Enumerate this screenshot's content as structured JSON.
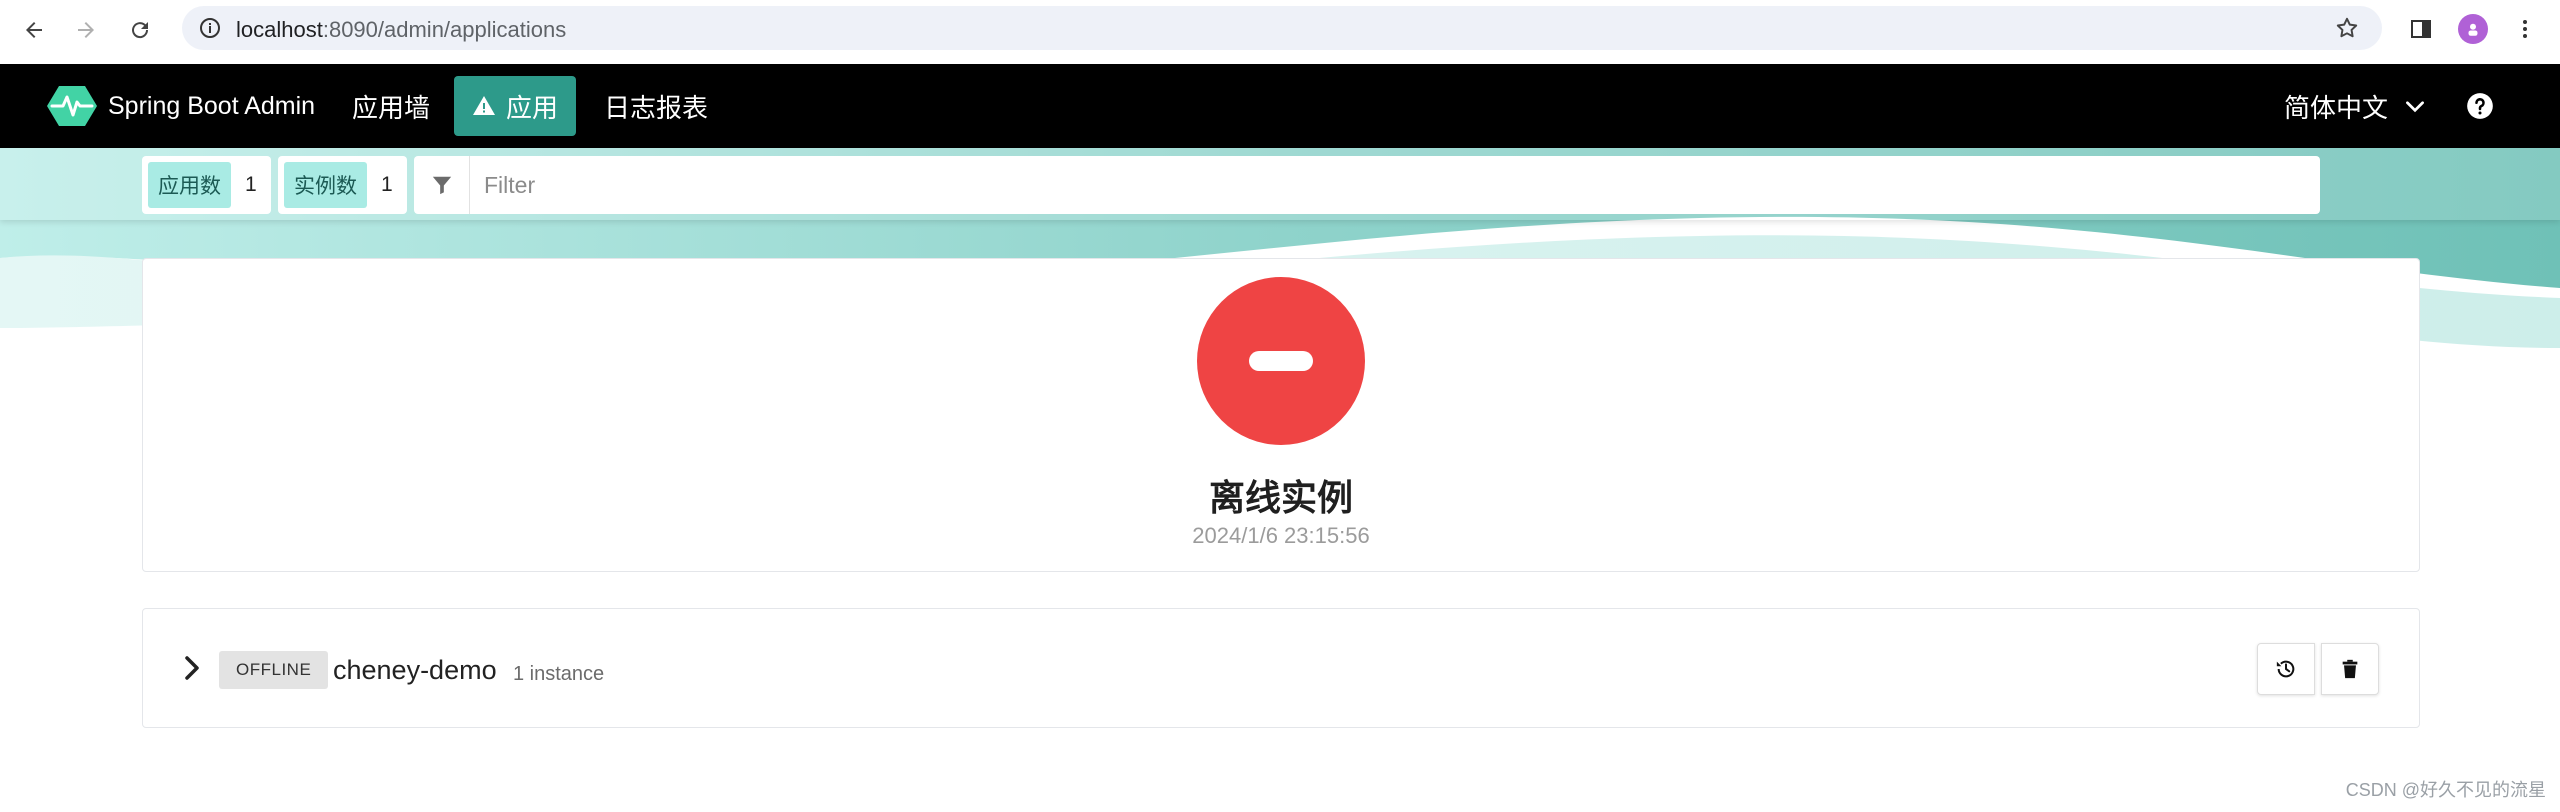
{
  "browser": {
    "url_host": "localhost",
    "url_rest": ":8090/admin/applications"
  },
  "navbar": {
    "brand": "Spring Boot Admin",
    "items": [
      {
        "label": "应用墙"
      },
      {
        "label": "应用"
      },
      {
        "label": "日志报表"
      }
    ],
    "language": "简体中文"
  },
  "toolbar": {
    "apps_label": "应用数",
    "apps_count": "1",
    "instances_label": "实例数",
    "instances_count": "1",
    "filter_placeholder": "Filter"
  },
  "status": {
    "title": "离线实例",
    "timestamp": "2024/1/6 23:15:56",
    "color": "#ef4444"
  },
  "application": {
    "status": "OFFLINE",
    "name": "cheney-demo",
    "instances": "1 instance"
  },
  "watermark": "CSDN @好久不见的流星",
  "colors": {
    "accent": "#2d9a8a",
    "tag_bg": "#a9ebe4",
    "navbar": "#000000"
  }
}
